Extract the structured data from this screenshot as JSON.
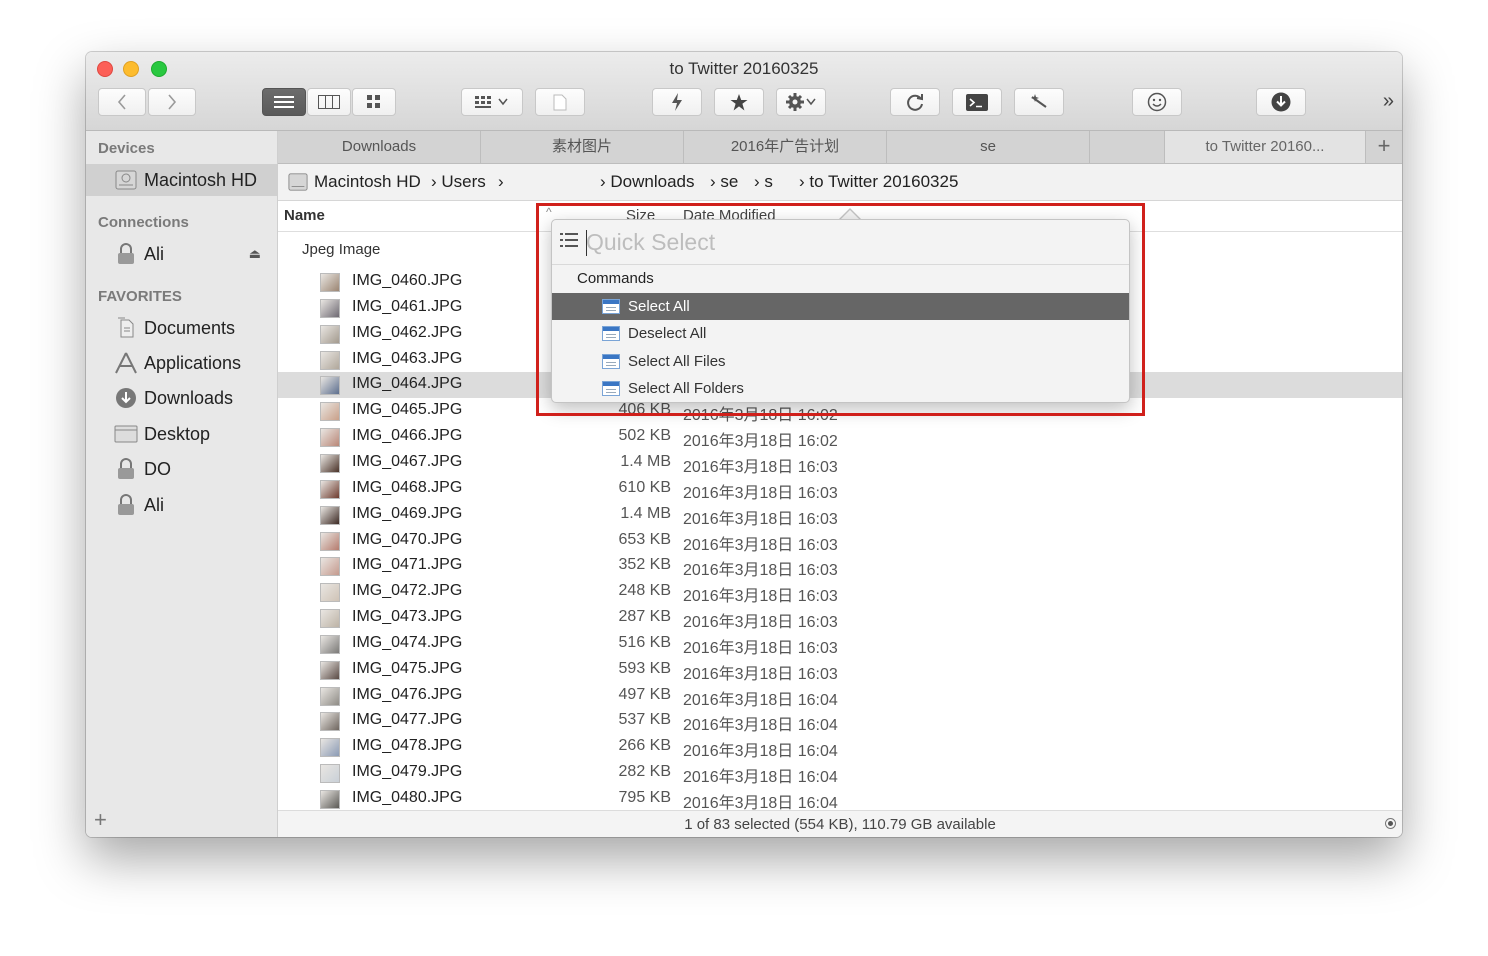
{
  "window": {
    "title": "to Twitter 20160325"
  },
  "toolbar": {
    "back_icon": "chevron-left-icon",
    "forward_icon": "chevron-right-icon",
    "view_modes": [
      "list-view-icon",
      "column-view-icon",
      "icon-view-icon"
    ],
    "arrange_icon": "grid-arrange-icon",
    "more_glyph": "»"
  },
  "sidebar": {
    "devices_header": "Devices",
    "devices": [
      {
        "label": "Macintosh HD",
        "icon": "hard-drive-icon"
      }
    ],
    "connections_header": "Connections",
    "connections": [
      {
        "label": "Ali",
        "icon": "lock-icon"
      }
    ],
    "favorites_header": "FAVORITES",
    "favorites": [
      {
        "label": "Documents",
        "icon": "documents-icon"
      },
      {
        "label": "Applications",
        "icon": "applications-icon"
      },
      {
        "label": "Downloads",
        "icon": "downloads-icon"
      },
      {
        "label": "Desktop",
        "icon": "desktop-icon"
      },
      {
        "label": "DO",
        "icon": "lock-icon"
      },
      {
        "label": "Ali",
        "icon": "lock-icon"
      }
    ],
    "add_label": "+"
  },
  "tabs": {
    "items": [
      "Downloads",
      "素材图片",
      "2016年广告计划",
      "se",
      "",
      "to Twitter 20160..."
    ],
    "add_label": "+"
  },
  "pathbar": {
    "segments": [
      "Macintosh HD",
      "› Users",
      "›",
      "› Downloads",
      "› se",
      "› s",
      "› to Twitter 20160325"
    ]
  },
  "columns": {
    "name": "Name",
    "size": "Size",
    "date": "Date Modified"
  },
  "group_label": "Jpeg Image",
  "files": [
    {
      "name": "IMG_0460.JPG",
      "size": "",
      "date": ""
    },
    {
      "name": "IMG_0461.JPG",
      "size": "",
      "date": ""
    },
    {
      "name": "IMG_0462.JPG",
      "size": "",
      "date": ""
    },
    {
      "name": "IMG_0463.JPG",
      "size": "",
      "date": ""
    },
    {
      "name": "IMG_0464.JPG",
      "size": "",
      "date": "",
      "selected": true
    },
    {
      "name": "IMG_0465.JPG",
      "size": "406 KB",
      "date": "2016年3月18日 16:02"
    },
    {
      "name": "IMG_0466.JPG",
      "size": "502 KB",
      "date": "2016年3月18日 16:02"
    },
    {
      "name": "IMG_0467.JPG",
      "size": "1.4 MB",
      "date": "2016年3月18日 16:03"
    },
    {
      "name": "IMG_0468.JPG",
      "size": "610 KB",
      "date": "2016年3月18日 16:03"
    },
    {
      "name": "IMG_0469.JPG",
      "size": "1.4 MB",
      "date": "2016年3月18日 16:03"
    },
    {
      "name": "IMG_0470.JPG",
      "size": "653 KB",
      "date": "2016年3月18日 16:03"
    },
    {
      "name": "IMG_0471.JPG",
      "size": "352 KB",
      "date": "2016年3月18日 16:03"
    },
    {
      "name": "IMG_0472.JPG",
      "size": "248 KB",
      "date": "2016年3月18日 16:03"
    },
    {
      "name": "IMG_0473.JPG",
      "size": "287 KB",
      "date": "2016年3月18日 16:03"
    },
    {
      "name": "IMG_0474.JPG",
      "size": "516 KB",
      "date": "2016年3月18日 16:03"
    },
    {
      "name": "IMG_0475.JPG",
      "size": "593 KB",
      "date": "2016年3月18日 16:03"
    },
    {
      "name": "IMG_0476.JPG",
      "size": "497 KB",
      "date": "2016年3月18日 16:04"
    },
    {
      "name": "IMG_0477.JPG",
      "size": "537 KB",
      "date": "2016年3月18日 16:04"
    },
    {
      "name": "IMG_0478.JPG",
      "size": "266 KB",
      "date": "2016年3月18日 16:04"
    },
    {
      "name": "IMG_0479.JPG",
      "size": "282 KB",
      "date": "2016年3月18日 16:04"
    },
    {
      "name": "IMG_0480.JPG",
      "size": "795 KB",
      "date": "2016年3月18日 16:04"
    }
  ],
  "status": {
    "text": "1 of 83 selected (554 KB), 110.79 GB available"
  },
  "quick_select": {
    "placeholder": "Quick Select",
    "value": "",
    "section": "Commands",
    "items": [
      {
        "label": "Select All",
        "selected": true
      },
      {
        "label": "Deselect All"
      },
      {
        "label": "Select All Files"
      },
      {
        "label": "Select All Folders"
      }
    ]
  },
  "colors": {
    "highlight_border": "#d0201b",
    "selected_menu_item": "#666666",
    "close": "#fc5f57",
    "minimize": "#fdbc2e",
    "maximize": "#29c840"
  }
}
